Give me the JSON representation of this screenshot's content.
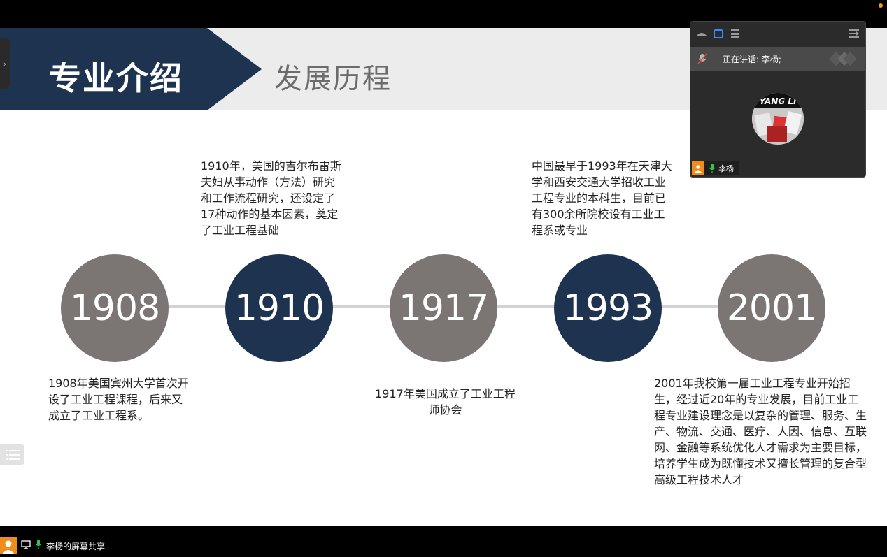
{
  "slide": {
    "title": "专业介绍",
    "subtitle": "发展历程",
    "milestones": [
      {
        "year": "1908",
        "text": "1908年美国宾州大学首次开设了工业工程课程，后来又成立了工业工程系。"
      },
      {
        "year": "1910",
        "text": "1910年，美国的吉尔布雷斯夫妇从事动作（方法）研究和工作流程研究，还设定了17种动作的基本因素，奠定了工业工程基础"
      },
      {
        "year": "1917",
        "text": "1917年美国成立了工业工程师协会"
      },
      {
        "year": "1993",
        "text": "中国最早于1993年在天津大学和西安交通大学招收工业工程专业的本科生，目前已有300余所院校设有工业工程系或专业"
      },
      {
        "year": "2001",
        "text": "2001年我校第一届工业工程专业开始招生，经过近20年的专业发展，目前工业工程专业建设理念是以复杂的管理、服务、生产、物流、交通、医疗、人因、信息、互联网、金融等系统优化人才需求为主要目标，培养学生成为既懂技术又擅长管理的复合型高级工程技术人才"
      }
    ]
  },
  "video_panel": {
    "speaking_text": "正在讲话: 李杨;",
    "avatar_text": "YANG LI",
    "participant_name": "李杨"
  },
  "bottom_bar": {
    "share_label": "李杨的屏幕共享"
  },
  "colors": {
    "navy": "#1e3350",
    "gray_circle": "#7b7574",
    "accent_orange": "#f08c1e",
    "mic_green": "#2ecc40"
  }
}
